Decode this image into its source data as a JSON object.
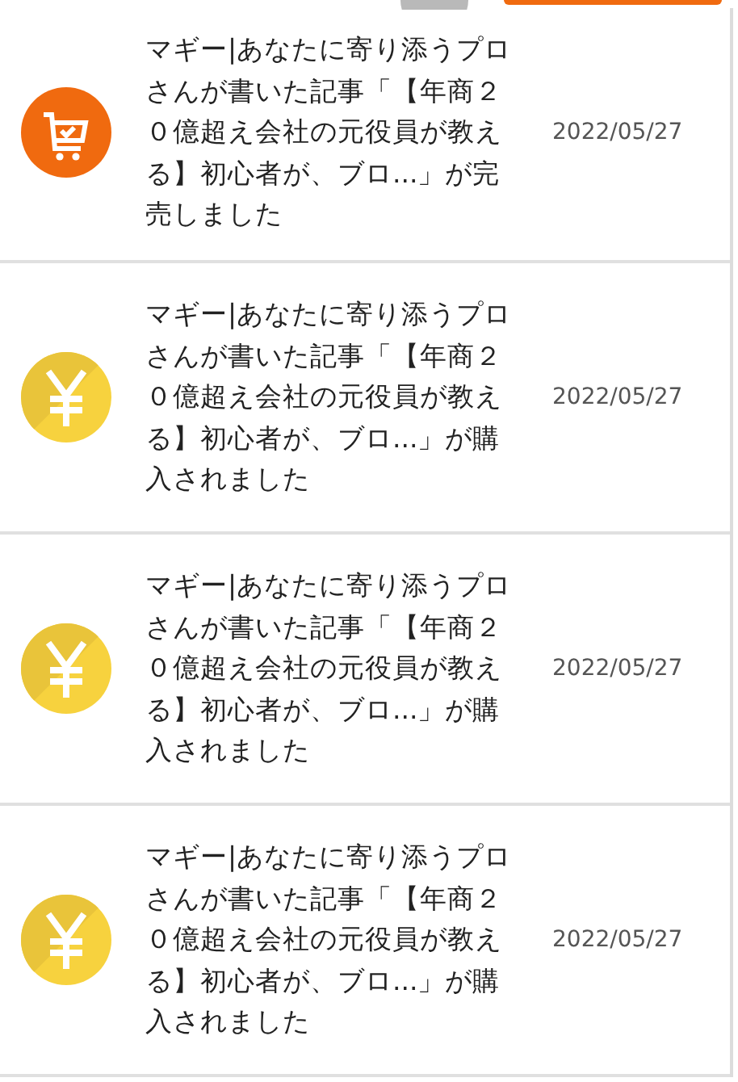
{
  "notifications": [
    {
      "kind": "cart",
      "message": "マギー|あなたに寄り添うプロさんが書いた記事「【年商２０億超え会社の元役員が教える】初心者が、ブロ...」が完売しました",
      "date": "2022/05/27"
    },
    {
      "kind": "yen",
      "message": "マギー|あなたに寄り添うプロさんが書いた記事「【年商２０億超え会社の元役員が教える】初心者が、ブロ...」が購入されました",
      "date": "2022/05/27"
    },
    {
      "kind": "yen",
      "message": "マギー|あなたに寄り添うプロさんが書いた記事「【年商２０億超え会社の元役員が教える】初心者が、ブロ...」が購入されました",
      "date": "2022/05/27"
    },
    {
      "kind": "yen",
      "message": "マギー|あなたに寄り添うプロさんが書いた記事「【年商２０億超え会社の元役員が教える】初心者が、ブロ...」が購入されました",
      "date": "2022/05/27"
    }
  ]
}
